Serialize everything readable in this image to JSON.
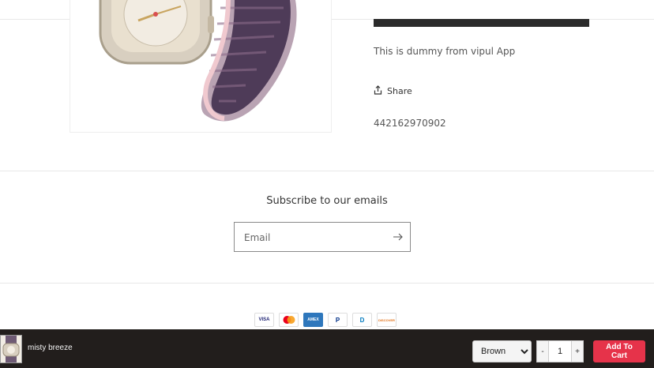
{
  "product": {
    "description": "This is dummy from vipul App",
    "share_label": "Share",
    "sku": "442162970902"
  },
  "newsletter": {
    "title": "Subscribe to our emails",
    "email_placeholder": "Email"
  },
  "payments": [
    {
      "name": "visa-icon",
      "label": "VISA"
    },
    {
      "name": "mastercard-icon",
      "label": ""
    },
    {
      "name": "amex-icon",
      "label": "AMEX"
    },
    {
      "name": "paypal-icon",
      "label": "P"
    },
    {
      "name": "diners-icon",
      "label": "D"
    },
    {
      "name": "discover-icon",
      "label": "DISCOVER"
    }
  ],
  "sticky_cart": {
    "product_name": "misty breeze",
    "variant_selected": "Brown",
    "quantity": "1",
    "minus_label": "-",
    "plus_label": "+",
    "add_to_cart_label": "Add To Cart"
  },
  "colors": {
    "accent": "#e6334a",
    "sticky_bg": "#221e1c"
  }
}
